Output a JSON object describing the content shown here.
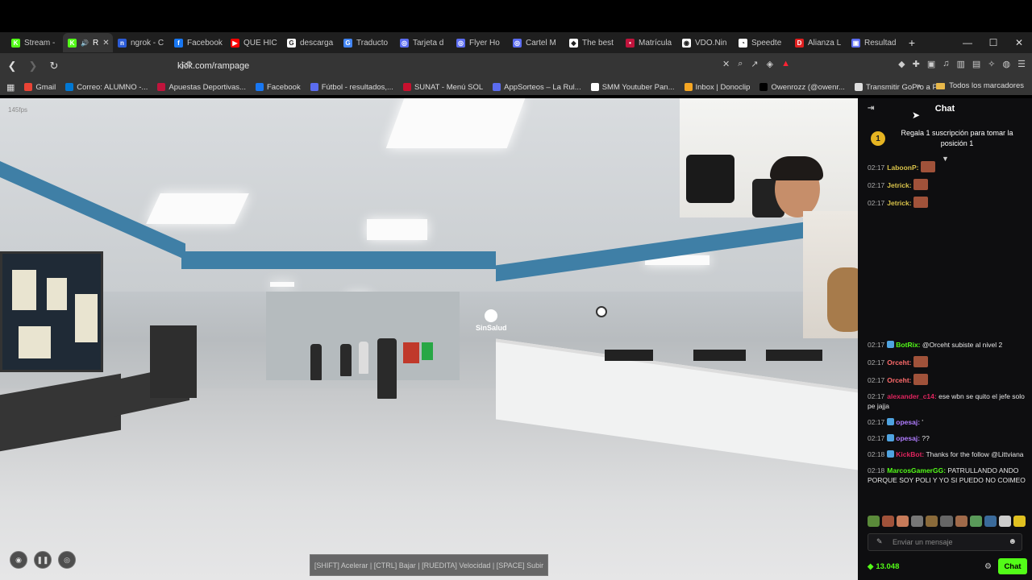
{
  "tabs": [
    {
      "label": "Stream -",
      "color": "#53fc18",
      "glyph": "K"
    },
    {
      "label": "R",
      "color": "#53fc18",
      "glyph": "K",
      "active": true
    },
    {
      "label": "ngrok - C",
      "color": "#2b5bd7",
      "glyph": "n"
    },
    {
      "label": "Facebook",
      "color": "#1877f2",
      "glyph": "f"
    },
    {
      "label": "QUE HIC",
      "color": "#ff0000",
      "glyph": "▶"
    },
    {
      "label": "descarga",
      "color": "#ffffff",
      "glyph": "G"
    },
    {
      "label": "Traducto",
      "color": "#4285f4",
      "glyph": "G"
    },
    {
      "label": "Tarjeta d",
      "color": "#5b6cf0",
      "glyph": "◎"
    },
    {
      "label": "Flyer Ho",
      "color": "#5b6cf0",
      "glyph": "◎"
    },
    {
      "label": "Cartel M",
      "color": "#5b6cf0",
      "glyph": "◎"
    },
    {
      "label": "The best",
      "color": "#ffffff",
      "glyph": "◆"
    },
    {
      "label": "Matrícula",
      "color": "#c0143c",
      "glyph": "•"
    },
    {
      "label": "VDO.Nin",
      "color": "#ffffff",
      "glyph": "◉"
    },
    {
      "label": "Speedte",
      "color": "#ffffff",
      "glyph": "◔"
    },
    {
      "label": "Alianza L",
      "color": "#e02020",
      "glyph": "D"
    },
    {
      "label": "Resultad",
      "color": "#5b6cf0",
      "glyph": "▣"
    }
  ],
  "address": {
    "url": "kick.com/rampage"
  },
  "bookmarks": [
    {
      "label": "Gmail",
      "color": "#ea4335"
    },
    {
      "label": "Correo: ALUMNO -...",
      "color": "#0078d4"
    },
    {
      "label": "Apuestas Deportivas...",
      "color": "#c0143c"
    },
    {
      "label": "Facebook",
      "color": "#1877f2"
    },
    {
      "label": "Fútbol - resultados,...",
      "color": "#5b6cf0"
    },
    {
      "label": "SUNAT - Menú SOL",
      "color": "#c8102e"
    },
    {
      "label": "AppSorteos – La Rul...",
      "color": "#5b6cf0"
    },
    {
      "label": "SMM Youtuber Pan...",
      "color": "#ffffff"
    },
    {
      "label": "Inbox | Donoclip",
      "color": "#f5a623"
    },
    {
      "label": "Owenrozz (@owenr...",
      "color": "#000000"
    },
    {
      "label": "Transmitir GoPro a PC",
      "color": "#dddddd"
    }
  ],
  "bookmarks_all": "Todos los marcadores",
  "game": {
    "fps": "145fps",
    "hint": "[SHIFT] Acelerar | [CTRL] Bajar | [RUEDITA] Velocidad | [SPACE] Subir",
    "sign": "SinSalud"
  },
  "chat": {
    "title": "Chat",
    "pinned": "Regala 1 suscripción para tomar la posición 1",
    "pinned_rank": "1",
    "messages_top": [
      {
        "time": "02:17",
        "user": "LaboonP:",
        "color": "#d8c24a",
        "emote": true
      },
      {
        "time": "02:17",
        "user": "Jetrick:",
        "color": "#d8c24a",
        "emote": true
      },
      {
        "time": "02:17",
        "user": "Jetrick:",
        "color": "#d8c24a",
        "emote": true
      }
    ],
    "messages": [
      {
        "time": "02:17",
        "user": "BotRix:",
        "color": "#53fc18",
        "text": "@Orceht subiste al nivel 2",
        "badge": "#4fa3e0"
      },
      {
        "time": "02:17",
        "user": "Orceht:",
        "color": "#ff6b6b",
        "text": "",
        "emote": true
      },
      {
        "time": "02:17",
        "user": "Orceht:",
        "color": "#ff6b6b",
        "text": "",
        "emote": true
      },
      {
        "time": "02:17",
        "user": "alexander_c14:",
        "color": "#e0245e",
        "text": "ese wbn se quito el jefe solo pe jajja"
      },
      {
        "time": "02:17",
        "user": "opesaj:",
        "color": "#b07cff",
        "text": "'",
        "badge": "#4fa3e0"
      },
      {
        "time": "02:17",
        "user": "opesaj:",
        "color": "#b07cff",
        "text": "??",
        "badge": "#4fa3e0"
      },
      {
        "time": "02:18",
        "user": "KickBot:",
        "color": "#e0245e",
        "text": "Thanks for the follow @Littviana",
        "badge": "#4fa3e0"
      },
      {
        "time": "02:18",
        "user": "MarcosGamerGG:",
        "color": "#53fc18",
        "text": "PATRULLANDO ANDO PORQUE SOY POLI Y YO SI PUEDO NO COIMEO"
      }
    ],
    "input_placeholder": "Enviar un mensaje",
    "points": "13.048",
    "send_label": "Chat"
  }
}
